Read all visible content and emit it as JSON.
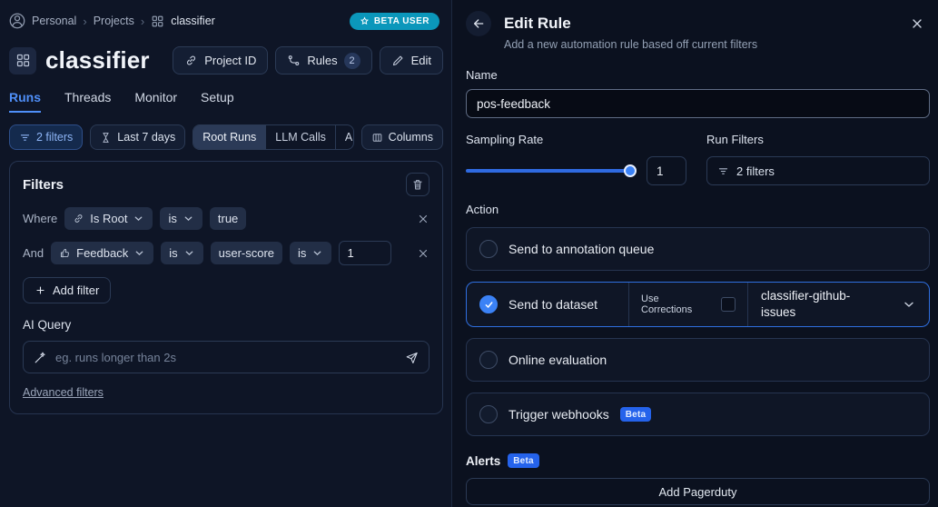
{
  "colors": {
    "accent_blue": "#3b82f6",
    "selected_card_border": "#2f6fe0",
    "beta_user_badge_bg": "#0b97bb",
    "beta_badge_bg": "#2563eb",
    "active_tab": "#4f8ff8"
  },
  "breadcrumb": {
    "personal": "Personal",
    "projects": "Projects",
    "project": "classifier",
    "beta_badge": "BETA USER"
  },
  "header": {
    "title": "classifier",
    "project_id_button": "Project ID",
    "rules_button": "Rules",
    "rules_count": "2",
    "edit_button": "Edit"
  },
  "tabs": [
    {
      "label": "Runs",
      "active": true
    },
    {
      "label": "Threads",
      "active": false
    },
    {
      "label": "Monitor",
      "active": false
    },
    {
      "label": "Setup",
      "active": false
    }
  ],
  "filter_bar": {
    "filters_button": "2 filters",
    "time_button": "Last 7 days",
    "segments": [
      "Root Runs",
      "LLM Calls",
      "All Runs"
    ],
    "columns_button": "Columns"
  },
  "filters_panel": {
    "title": "Filters",
    "row1": {
      "prefix": "Where",
      "field": "Is Root",
      "operator": "is",
      "value": "true"
    },
    "row2": {
      "prefix": "And",
      "field": "Feedback",
      "operator1": "is",
      "key": "user-score",
      "operator2": "is",
      "value": "1"
    },
    "add_filter_button": "Add filter",
    "ai_query_label": "AI Query",
    "ai_query_placeholder": "eg. runs longer than 2s",
    "advanced_filters_link": "Advanced filters"
  },
  "edit_rule": {
    "title": "Edit Rule",
    "subtitle": "Add a new automation rule based off current filters",
    "name_label": "Name",
    "name_value": "pos-feedback",
    "sampling_rate_label": "Sampling Rate",
    "sampling_rate_value": "1",
    "run_filters_label": "Run Filters",
    "run_filters_button": "2 filters",
    "action_label": "Action",
    "options": [
      {
        "label": "Send to annotation queue",
        "selected": false
      },
      {
        "label": "Send to dataset",
        "selected": true,
        "use_corrections_label": "Use Corrections",
        "corrections_checked": false,
        "dataset_value": "classifier-github-issues"
      },
      {
        "label": "Online evaluation",
        "selected": false
      },
      {
        "label": "Trigger webhooks",
        "selected": false,
        "beta_badge": "Beta"
      }
    ],
    "alerts_label": "Alerts",
    "alerts_beta_badge": "Beta",
    "add_pagerduty_button": "Add Pagerduty"
  },
  "icons": {
    "user-avatar-icon": "person outline",
    "breadcrumb-separator-icon": "›",
    "project-grid-icon": "four-square grid",
    "star-icon": "star outline",
    "link-icon": "chain link",
    "rules-icon": "route with nodes",
    "edit-icon": "pencil",
    "filter-icon": "funnel lines",
    "hourglass-icon": "hourglass",
    "columns-icon": "table columns",
    "trash-icon": "trash can",
    "chevron-down-icon": "⌄",
    "close-icon": "✕",
    "thumbs-up-icon": "thumbs up",
    "plus-icon": "+",
    "wand-icon": "magic wand",
    "send-icon": "paper plane",
    "back-arrow-icon": "←",
    "check-icon": "✓"
  }
}
